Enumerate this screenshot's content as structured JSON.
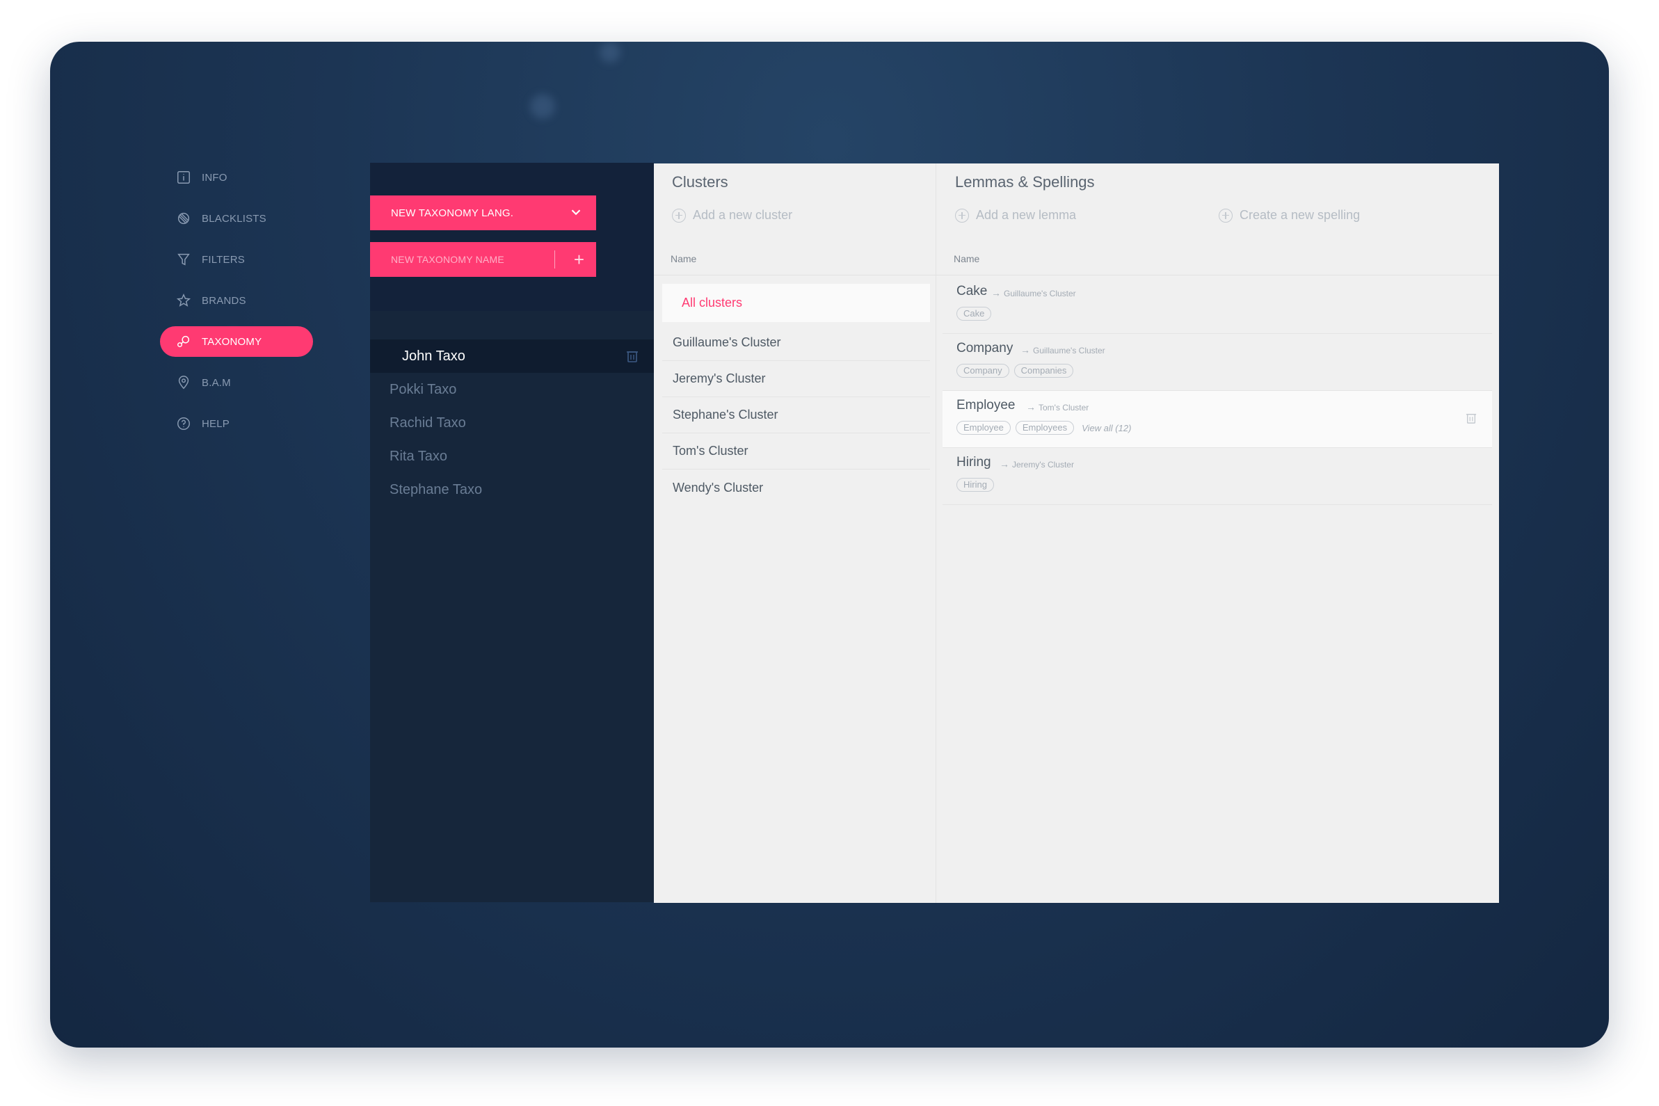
{
  "nav": {
    "items": [
      {
        "label": "INFO",
        "icon": "info-icon"
      },
      {
        "label": "BLACKLISTS",
        "icon": "blacklist-icon"
      },
      {
        "label": "FILTERS",
        "icon": "filter-icon"
      },
      {
        "label": "BRANDS",
        "icon": "star-icon"
      },
      {
        "label": "TAXONOMY",
        "icon": "taxonomy-icon",
        "active": true
      },
      {
        "label": "B.A.M",
        "icon": "location-pin-icon"
      },
      {
        "label": "HELP",
        "icon": "help-icon"
      }
    ]
  },
  "taxonomy": {
    "lang_select_label": "NEW TAXONOMY LANG.",
    "name_placeholder": "NEW TAXONOMY NAME",
    "add_symbol": "+",
    "items": [
      "John Taxo",
      "Pokki Taxo",
      "Rachid Taxo",
      "Rita Taxo",
      "Stephane Taxo"
    ],
    "active_index": 0
  },
  "clusters": {
    "title": "Clusters",
    "add_label": "Add a new cluster",
    "column_name": "Name",
    "items": [
      "All clusters",
      "Guillaume's Cluster",
      "Jeremy's Cluster",
      "Stephane's Cluster",
      "Tom's Cluster",
      "Wendy's Cluster"
    ],
    "active_index": 0
  },
  "lemmas": {
    "title": "Lemmas & Spellings",
    "add_lemma_label": "Add a new lemma",
    "add_spelling_label": "Create a new spelling",
    "column_name": "Name",
    "items": [
      {
        "name": "Cake",
        "cluster": "Guillaume's Cluster",
        "spellings": [
          "Cake"
        ],
        "view_all": ""
      },
      {
        "name": "Company",
        "cluster": "Guillaume's Cluster",
        "spellings": [
          "Company",
          "Companies"
        ],
        "view_all": ""
      },
      {
        "name": "Employee",
        "cluster": "Tom's Cluster",
        "spellings": [
          "Employee",
          "Employees"
        ],
        "view_all": "View all (12)",
        "highlighted": true
      },
      {
        "name": "Hiring",
        "cluster": "Jeremy's Cluster",
        "spellings": [
          "Hiring"
        ],
        "view_all": ""
      }
    ]
  },
  "colors": {
    "accent": "#ff3a72",
    "dark_panel": "#16263b",
    "light_panel": "#f0f0f0"
  }
}
